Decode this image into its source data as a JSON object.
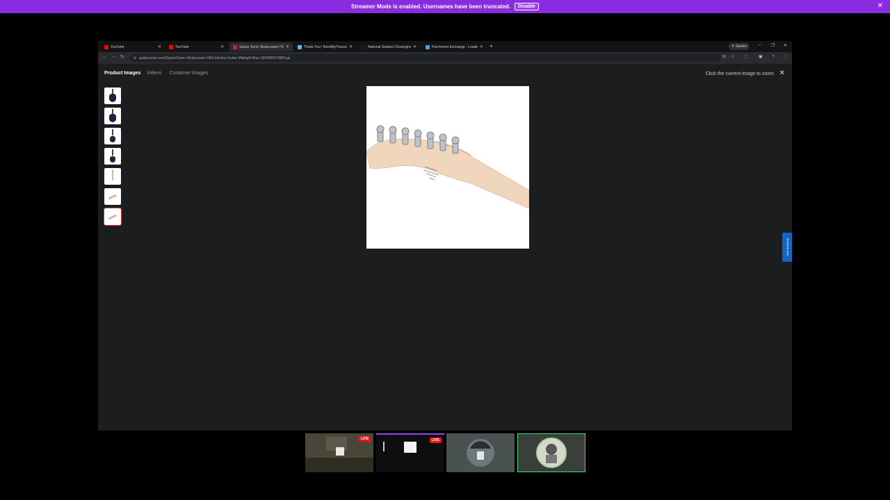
{
  "banner": {
    "text": "Streamer Mode is enabled. Usernames have been truncated.",
    "button": "Disable"
  },
  "tabs": [
    {
      "title": "YouTube",
      "favicon_color": "#ff0000"
    },
    {
      "title": "YouTube",
      "favicon_color": "#ff0000"
    },
    {
      "title": "Squier Sonic Stratocaster HSS E",
      "favicon_color": "#c62828"
    },
    {
      "title": "Thank You | NeedMyTranscript",
      "favicon_color": "#64b5f6"
    },
    {
      "title": "National Student Clearinghouse",
      "favicon_color": "#1c1d1f"
    },
    {
      "title": "Parchment Exchange - Leader",
      "favicon_color": "#42a5f5"
    }
  ],
  "gemini_label": "Gemini",
  "url": "guitarcenter.com/Squier/Sonic-Stratocaster-HSS-Electric-Guitar-Midnight-Blue-1500000473860.gc",
  "viewer": {
    "tabs": [
      "Product Images",
      "Videos",
      "Customer Images"
    ],
    "active_tab": "Product Images",
    "zoom_hint": "Click the current image to zoom",
    "thumbnail_count": 7,
    "selected_thumbnail": 7
  },
  "feedback_label": "Give feedback",
  "streams": [
    {
      "live": "LIVE"
    },
    {
      "live": "LIVE"
    },
    {
      "live": ""
    },
    {
      "live": ""
    }
  ]
}
